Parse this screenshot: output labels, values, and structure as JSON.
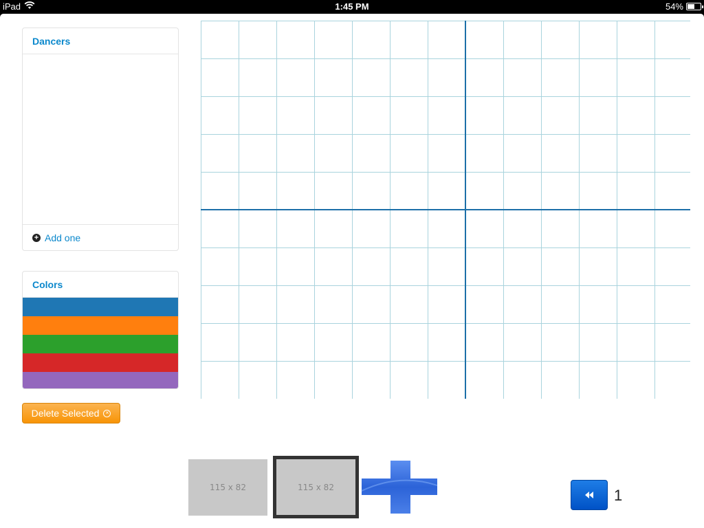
{
  "status_bar": {
    "device": "iPad",
    "time": "1:45 PM",
    "battery": "54%",
    "battery_level": 0.54
  },
  "dancers_panel": {
    "title": "Dancers",
    "add_label": "Add one"
  },
  "colors_panel": {
    "title": "Colors",
    "swatches": [
      "#1f77b4",
      "#ff7f0e",
      "#2ca02c",
      "#d62728",
      "#9467bd"
    ]
  },
  "delete_button": {
    "label": "Delete Selected"
  },
  "grid": {
    "line_color": "#a9d3dd",
    "axis_color": "#1b6fa8"
  },
  "thumbnails": [
    {
      "label": "115 x 82",
      "selected": false
    },
    {
      "label": "115 x 82",
      "selected": true
    }
  ],
  "pager": {
    "current_page": "1"
  }
}
